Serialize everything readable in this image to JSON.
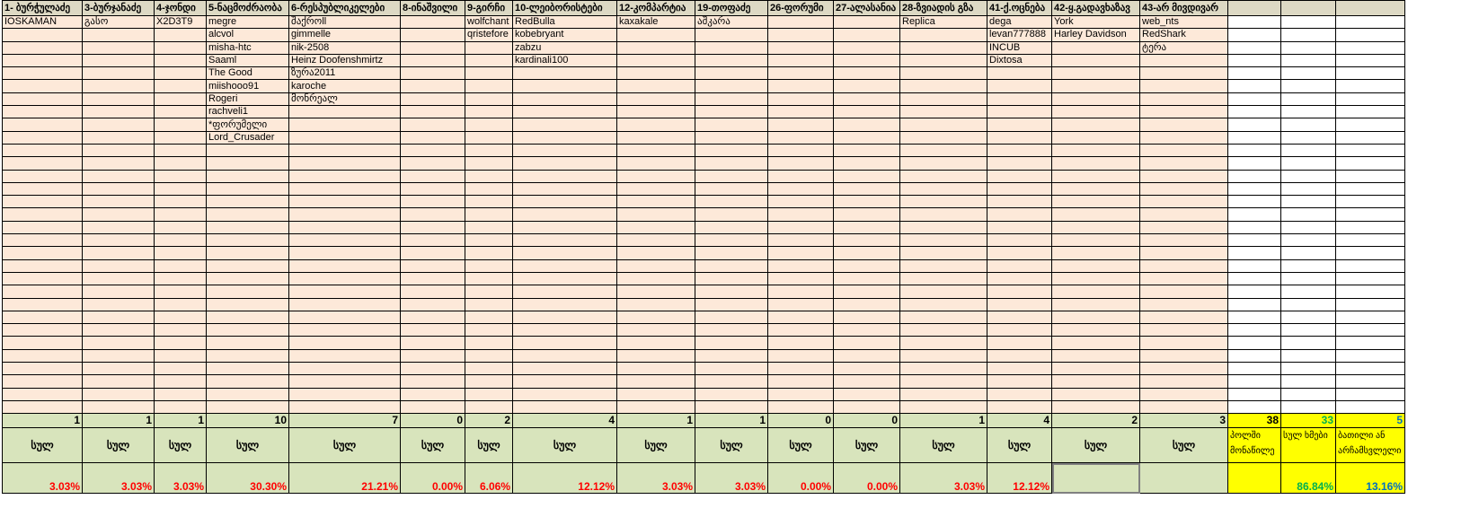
{
  "headers": [
    "1- ბურჭულაძე",
    "3-ბურჯანაძე",
    "4-ჯონდი",
    "5-ნაცმოძრაობა",
    "6-რესპუბლიკელები",
    "8-ინაშვილი",
    "9-გირჩი",
    "10-ლეიბორისტები",
    "12-კომპარტია",
    "19-თოფაძე",
    "26-ფორუმი",
    "27-ალასანია",
    "28-ზვიადის გზა",
    "41-ქ.ოცნება",
    "42-ყ.გადავხაზავ",
    "43-არ მივდივარ"
  ],
  "columns": [
    [
      "IOSKAMAN"
    ],
    [
      "გასო"
    ],
    [
      "X2D3T9"
    ],
    [
      "megre",
      "alcvol",
      "misha-htc",
      "Saaml",
      "The Good",
      "miishooo91",
      "Rogeri",
      "rachveli1",
      "*ფორუმელი",
      "Lord_Crusader"
    ],
    [
      "შაქროll",
      "gimmelle",
      "nik-2508",
      "Heinz Doofenshmirtz",
      "ზურა2011",
      "karoche",
      "მონრეალ"
    ],
    [],
    [
      "wolfchant",
      "qristefore"
    ],
    [
      "RedBulla",
      "kobebryant",
      "zabzu",
      "kardinali100"
    ],
    [
      "kaxakale"
    ],
    [
      "აშკარა"
    ],
    [],
    [],
    [
      "Replica"
    ],
    [
      "dega",
      "levan777888",
      "INCUB",
      "Dixtosa"
    ],
    [
      "York",
      "Harley Davidson"
    ],
    [
      "web_nts",
      "RedShark",
      "ტერა"
    ]
  ],
  "totals": [
    "1",
    "1",
    "1",
    "10",
    "7",
    "0",
    "2",
    "4",
    "1",
    "1",
    "0",
    "0",
    "1",
    "4",
    "2",
    "3"
  ],
  "total_label": "სულ",
  "percents": [
    "3.03%",
    "3.03%",
    "3.03%",
    "30.30%",
    "21.21%",
    "0.00%",
    "6.06%",
    "12.12%",
    "3.03%",
    "3.03%",
    "0.00%",
    "0.00%",
    "3.03%",
    "12.12%",
    "",
    ""
  ],
  "summary": {
    "total_count": "38",
    "valid_count": "33",
    "invalid_count": "5",
    "total_label": "პოლში მონაწილე",
    "valid_label": "სულ ხმები",
    "invalid_label": "ბათილი ან არჩამსვლელი",
    "valid_pct": "86.84%",
    "invalid_pct": "13.16%"
  }
}
